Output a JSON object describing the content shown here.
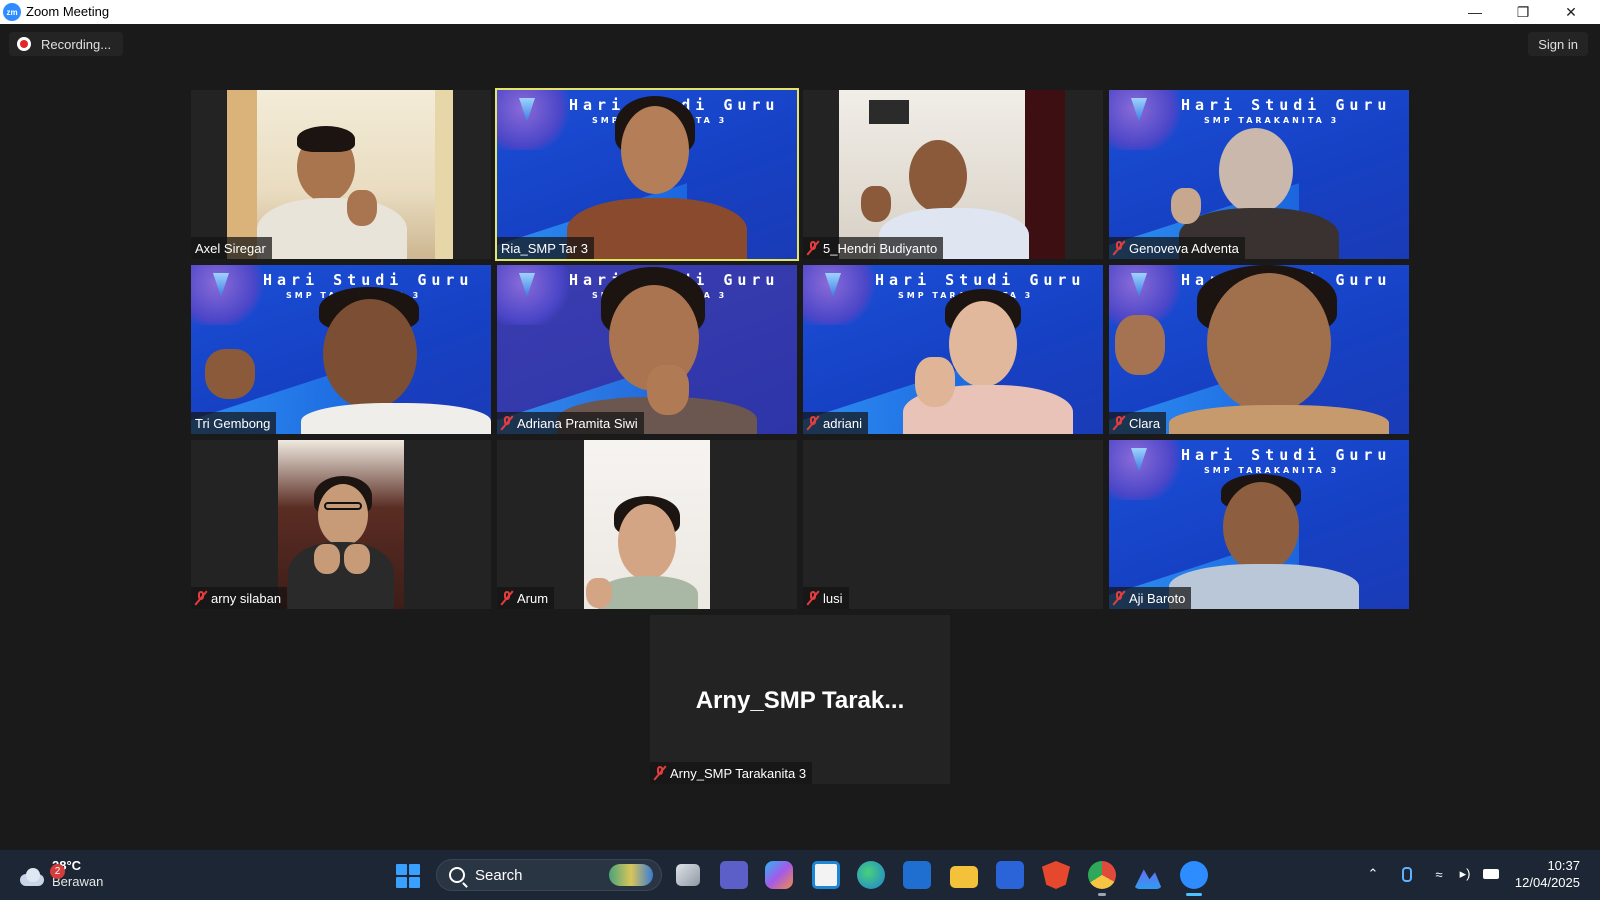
{
  "window": {
    "title": "Zoom Meeting",
    "app_icon_text": "zm",
    "controls": [
      "minimize",
      "restore",
      "close"
    ]
  },
  "toolbar": {
    "recording_label": "Recording...",
    "signin_label": "Sign in"
  },
  "banner": {
    "title": "Hari Studi Guru",
    "subtitle": "SMP TARAKANITA 3"
  },
  "participants": [
    {
      "name": "Axel Siregar",
      "muted": false,
      "video": "camera",
      "active": false
    },
    {
      "name": "Ria_SMP Tar 3",
      "muted": false,
      "video": "banner",
      "active": true
    },
    {
      "name": "5_Hendri Budiyanto",
      "muted": true,
      "video": "camera",
      "active": false
    },
    {
      "name": "Genoveva Adventa",
      "muted": true,
      "video": "banner",
      "active": false
    },
    {
      "name": "Tri Gembong",
      "muted": false,
      "video": "banner",
      "active": false
    },
    {
      "name": "Adriana Pramita Siwi",
      "muted": true,
      "video": "banner",
      "active": false
    },
    {
      "name": "adriani",
      "muted": true,
      "video": "banner",
      "active": false
    },
    {
      "name": "Clara",
      "muted": true,
      "video": "banner",
      "active": false
    },
    {
      "name": "arny silaban",
      "muted": true,
      "video": "camera",
      "active": false
    },
    {
      "name": "Arum",
      "muted": true,
      "video": "camera",
      "active": false
    },
    {
      "name": "lusi",
      "muted": true,
      "video": "off",
      "active": false
    },
    {
      "name": "Aji Baroto",
      "muted": true,
      "video": "banner",
      "active": false
    }
  ],
  "video_off_tile": {
    "display_name": "Arny_SMP  Tarak...",
    "name": "Arny_SMP Tarakanita 3",
    "muted": true
  },
  "taskbar": {
    "weather": {
      "temperature": "28°C",
      "description": "Berawan",
      "badge": "2"
    },
    "search_label": "Search",
    "apps": [
      "start-icon",
      "search-icon",
      "task-view-icon",
      "teams-icon",
      "copilot-icon",
      "store-icon",
      "edge-icon",
      "outlook-icon",
      "file-explorer-icon",
      "notes-icon",
      "brave-icon",
      "chrome-icon",
      "photos-icon",
      "zoom-icon"
    ],
    "tray": [
      "chevron-up-icon",
      "microphone-icon",
      "wifi-icon",
      "volume-icon",
      "battery-icon"
    ],
    "time": "10:37",
    "date": "12/04/2025"
  },
  "colors": {
    "meeting_bg": "#1a1a1a",
    "tile_bg": "#232323",
    "active_speaker": "#e4e466",
    "muted_red": "#e53d3d",
    "banner_blue": "#1b4fd6",
    "taskbar_bg": "#1c2634"
  }
}
